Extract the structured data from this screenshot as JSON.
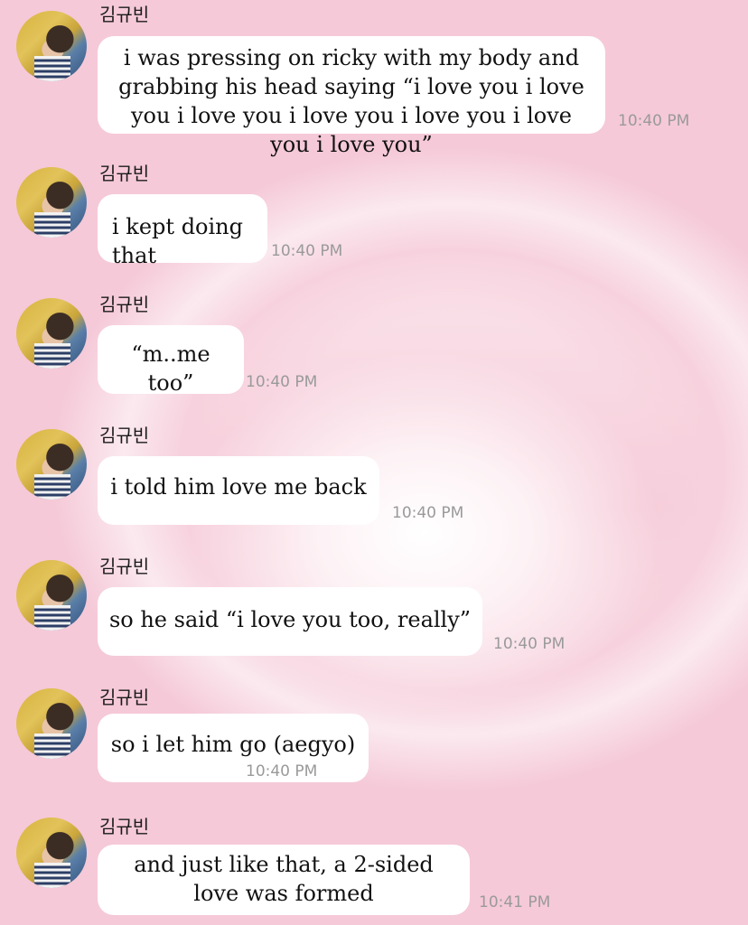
{
  "chat": {
    "sender_name": "김규빈",
    "messages": [
      {
        "text": "i was pressing on ricky with my body and grabbing his head saying “i love you i love you i love you i love you i love you i love you i love you”",
        "time": "10:40 PM"
      },
      {
        "text": "i kept doing that",
        "time": "10:40 PM"
      },
      {
        "text": "“m..me too”",
        "time": "10:40 PM"
      },
      {
        "text": "i told him love me back",
        "time": "10:40 PM"
      },
      {
        "text": "so he said “i love you too, really”",
        "time": "10:40 PM"
      },
      {
        "text": "so i let him go (aegyo)",
        "time": "10:40 PM"
      },
      {
        "text": "and just like that, a 2-sided love was formed",
        "time": "10:41 PM"
      }
    ]
  }
}
